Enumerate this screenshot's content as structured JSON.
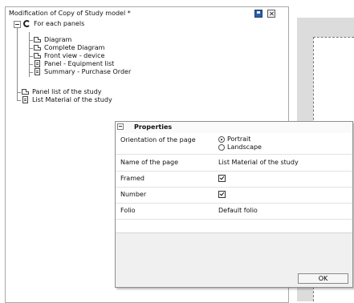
{
  "left_panel": {
    "title": "Modification of Copy of  Study model *",
    "tree": {
      "root": "For each panels",
      "children": [
        "Diagram",
        "Complete Diagram",
        "Front view - device",
        "Panel - Equipment list",
        "Summary - Purchase Order"
      ],
      "siblings": [
        "Panel list of the study",
        "List Material of the study"
      ]
    }
  },
  "dialog": {
    "title": "Properties",
    "rows": {
      "orientation": {
        "label": "Orientation of the page",
        "option_portrait": "Portrait",
        "option_landscape": "Landscape",
        "selected": "Portrait"
      },
      "name": {
        "label": "Name of the page",
        "value": "List Material of the study"
      },
      "framed": {
        "label": "Framed",
        "checked": true
      },
      "number": {
        "label": "Number",
        "checked": true
      },
      "folio": {
        "label": "Folio",
        "value": "Default folio"
      }
    },
    "ok_label": "OK"
  },
  "colors": {
    "save_icon": "#2c5fa8",
    "preview_bg": "#dcdcdc",
    "dialog_bg": "#f0f0f0"
  },
  "icons": [
    "save-icon",
    "close-icon",
    "loop-icon",
    "page-icon",
    "list-page-icon"
  ]
}
